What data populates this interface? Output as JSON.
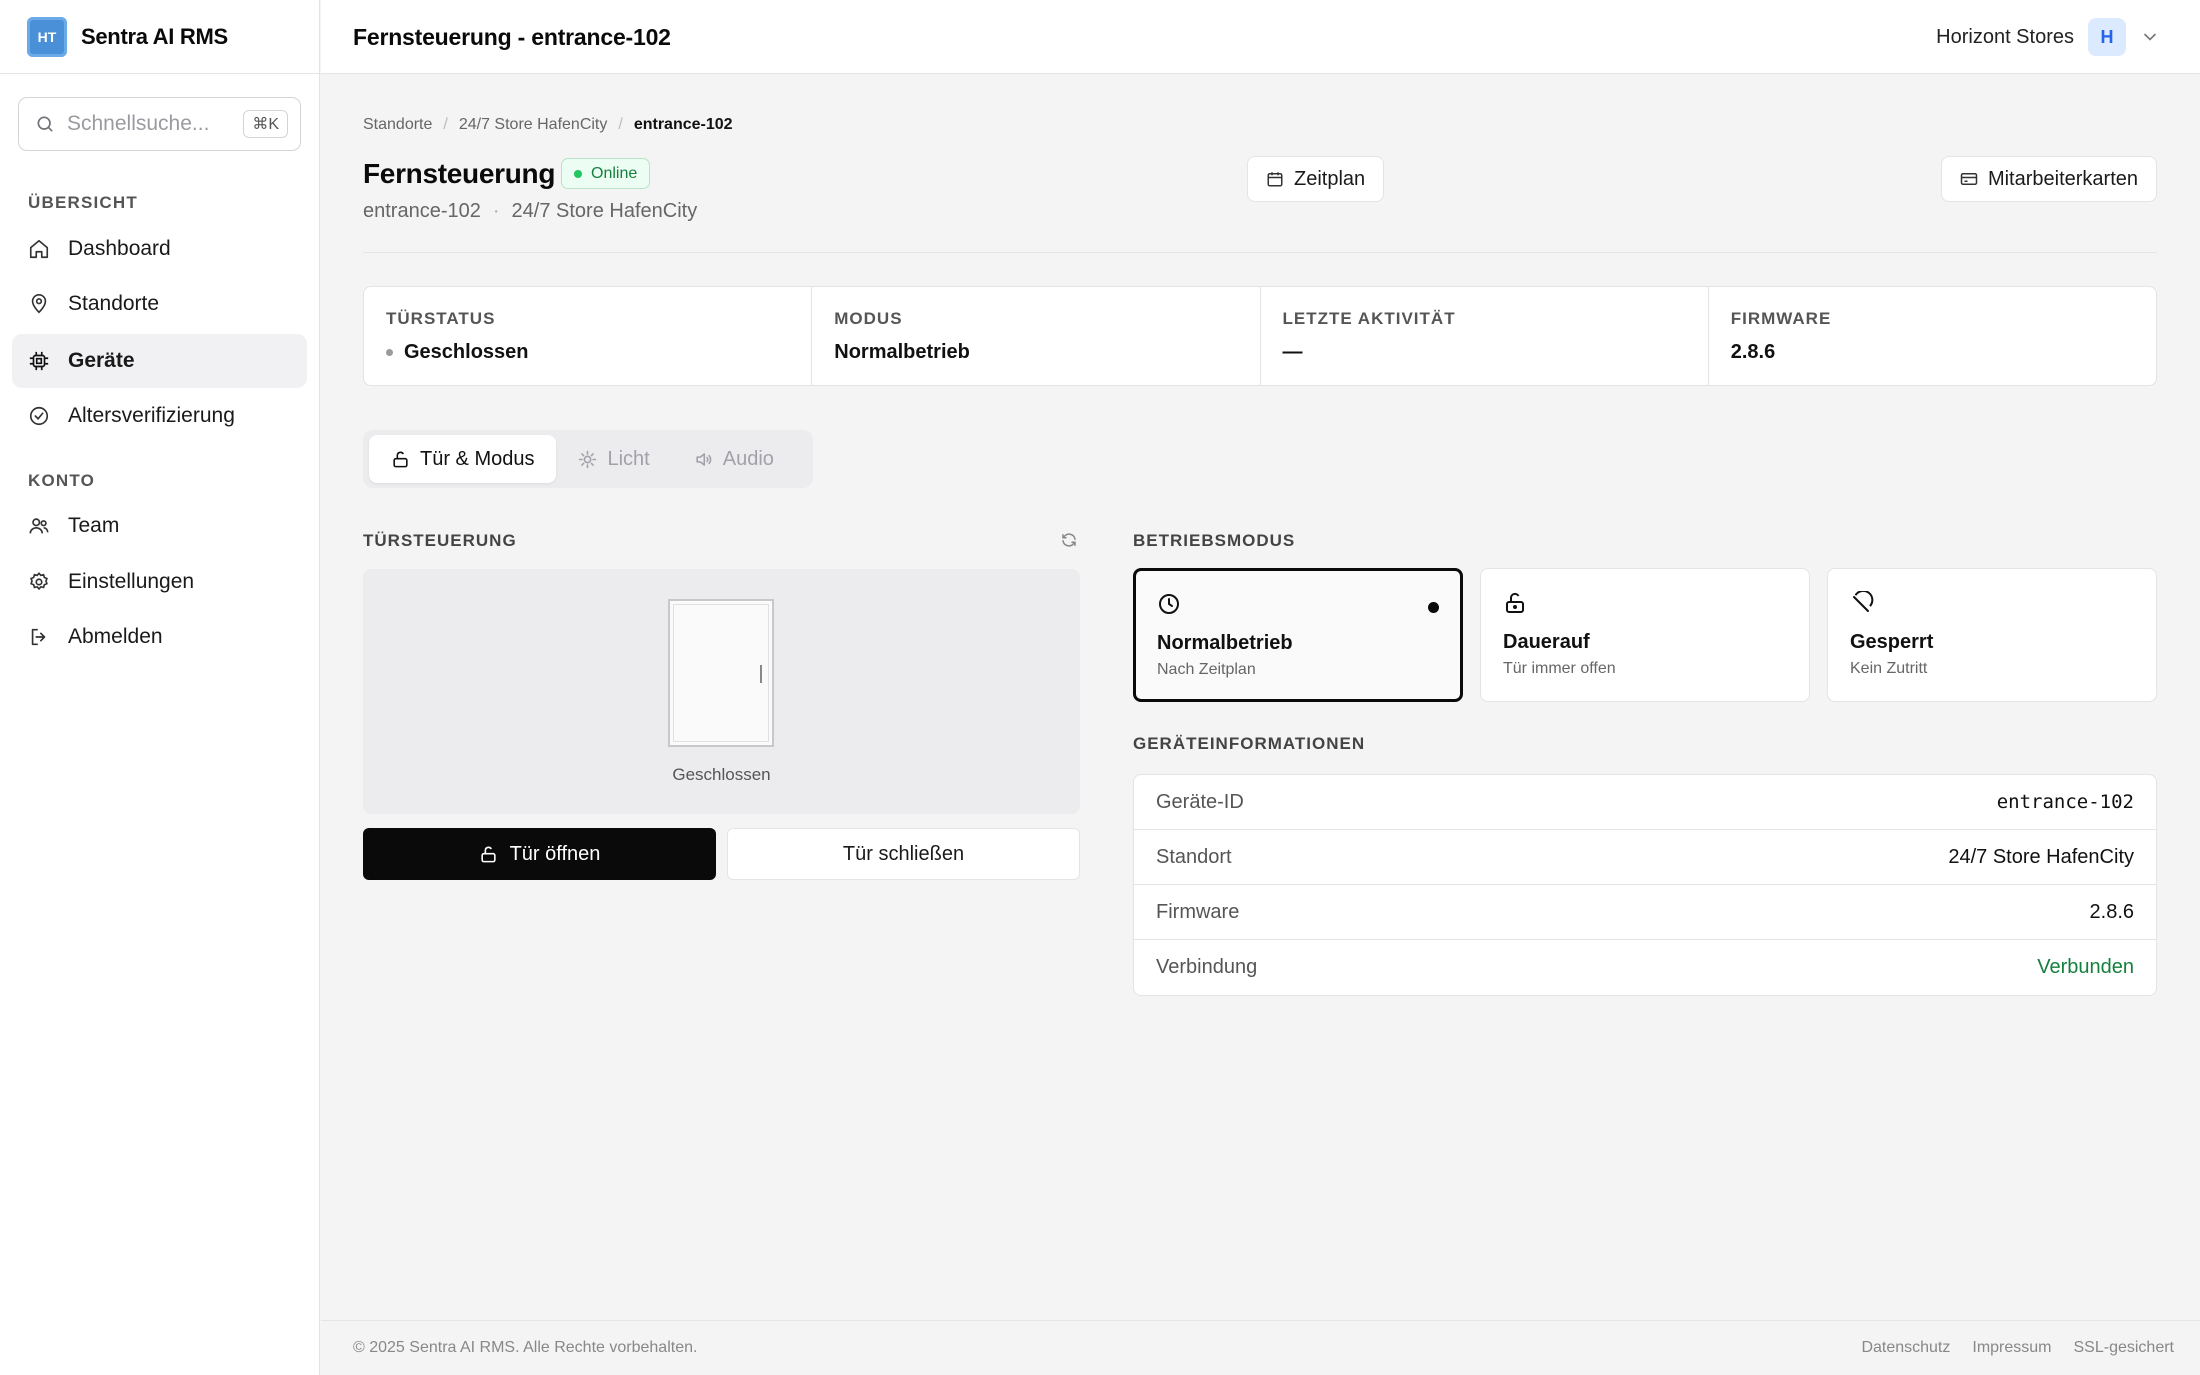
{
  "brand": {
    "logo_text": "HT",
    "name": "Sentra AI RMS"
  },
  "search": {
    "placeholder": "Schnellsuche...",
    "shortcut": "⌘K"
  },
  "sidebar": {
    "sections": [
      {
        "label": "ÜBERSICHT"
      },
      {
        "label": "KONTO"
      }
    ],
    "items": [
      {
        "label": "Dashboard",
        "icon": "home-icon"
      },
      {
        "label": "Standorte",
        "icon": "map-pin-icon"
      },
      {
        "label": "Geräte",
        "icon": "chip-icon",
        "active": true
      },
      {
        "label": "Altersverifizierung",
        "icon": "check-circle-icon"
      },
      {
        "label": "Team",
        "icon": "users-icon"
      },
      {
        "label": "Einstellungen",
        "icon": "gear-icon"
      },
      {
        "label": "Abmelden",
        "icon": "logout-icon"
      }
    ]
  },
  "header": {
    "title": "Fernsteuerung - entrance-102",
    "org_name": "Horizont Stores",
    "org_avatar": "H"
  },
  "breadcrumb": [
    "Standorte",
    "24/7 Store HafenCity",
    "entrance-102"
  ],
  "page": {
    "title": "Fernsteuerung",
    "status": "Online",
    "subtitle_device": "entrance-102",
    "subtitle_location": "24/7 Store HafenCity",
    "schedule_button": "Zeitplan",
    "cards_button": "Mitarbeiterkarten"
  },
  "stats": [
    {
      "label": "TÜRSTATUS",
      "value": "Geschlossen"
    },
    {
      "label": "MODUS",
      "value": "Normalbetrieb"
    },
    {
      "label": "LETZTE AKTIVITÄT",
      "value": "—"
    },
    {
      "label": "FIRMWARE",
      "value": "2.8.6"
    }
  ],
  "tabs": [
    {
      "label": "Tür & Modus",
      "icon": "lock-open-icon",
      "active": true
    },
    {
      "label": "Licht",
      "icon": "bulb-icon"
    },
    {
      "label": "Audio",
      "icon": "speaker-icon"
    }
  ],
  "door_control": {
    "section_label": "TÜRSTEUERUNG",
    "door_state": "Geschlossen",
    "open_button": "Tür öffnen",
    "close_button": "Tür schließen"
  },
  "operating_mode": {
    "section_label": "BETRIEBSMODUS",
    "modes": [
      {
        "title": "Normalbetrieb",
        "subtitle": "Nach Zeitplan",
        "icon": "clock-icon",
        "selected": true
      },
      {
        "title": "Dauerauf",
        "subtitle": "Tür immer offen",
        "icon": "lock-open-icon"
      },
      {
        "title": "Gesperrt",
        "subtitle": "Kein Zutritt",
        "icon": "ban-icon"
      }
    ]
  },
  "device_info": {
    "section_label": "GERÄTEINFORMATIONEN",
    "rows": [
      {
        "key": "Geräte-ID",
        "value": "entrance-102"
      },
      {
        "key": "Standort",
        "value": "24/7 Store HafenCity"
      },
      {
        "key": "Firmware",
        "value": "2.8.6"
      },
      {
        "key": "Verbindung",
        "value": "Verbunden"
      }
    ]
  },
  "footer": {
    "copyright": "© 2025 Sentra AI RMS. Alle Rechte vorbehalten.",
    "links": [
      "Datenschutz",
      "Impressum",
      "SSL-gesichert"
    ]
  },
  "colors": {
    "accent": "#0a0a0a",
    "online": "#15803d",
    "logo": "#4a90d9",
    "avatar_bg": "#dbeafe"
  }
}
